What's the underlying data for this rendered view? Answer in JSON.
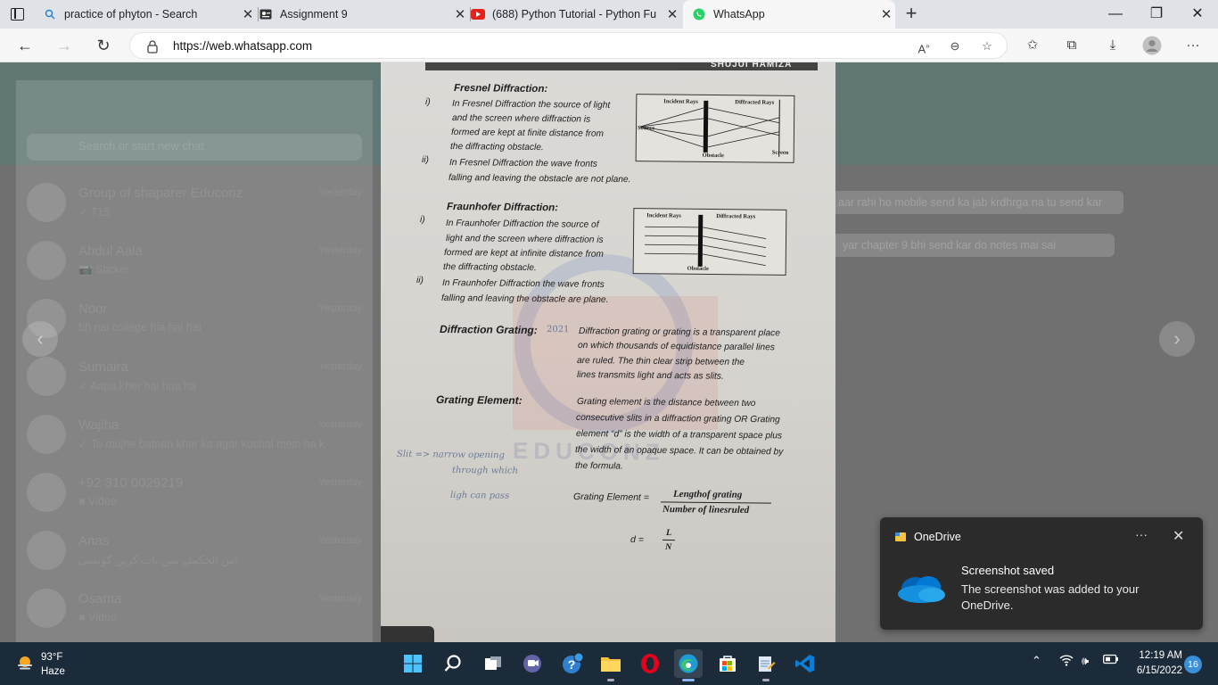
{
  "browser": {
    "tabs": [
      {
        "title": "practice of phyton - Search",
        "icon": "search-icon",
        "active": false
      },
      {
        "title": "Assignment 9",
        "icon": "assignment-icon",
        "active": false
      },
      {
        "title": "(688) Python Tutorial - Python Fu",
        "icon": "youtube-icon",
        "active": false
      },
      {
        "title": "WhatsApp",
        "icon": "whatsapp-icon",
        "active": true
      }
    ],
    "url": "https://web.whatsapp.com",
    "colors": {
      "tabstrip": "#dfe3e8",
      "toolbar": "#f7f7f7",
      "youtube": "#e62117",
      "whatsapp": "#25d366"
    }
  },
  "whatsapp": {
    "search_placeholder": "Search or start new chat",
    "chats": [
      {
        "name": "Group of shaparer Educonz",
        "msg": "✓ T15",
        "time": "Yesterday"
      },
      {
        "name": "Abdul Aala",
        "msg": "📷 Sticker",
        "time": "Yesterday"
      },
      {
        "name": "Noor",
        "msg": "bh nai college hia hai hai",
        "time": "Yesterday"
      },
      {
        "name": "Sumaira",
        "msg": "✓ Aapa kher hai hua ha",
        "time": "Yesterday"
      },
      {
        "name": "Wajiha",
        "msg": "✓ To mujhe batnah kher ka agar kuchal mein ha k",
        "time": "Yesterday"
      },
      {
        "name": "+92 310 0029219",
        "msg": "■ Video",
        "time": "Yesterday"
      },
      {
        "name": "Anas",
        "msg": "اس الحکمتے میں بات کریں کونسی",
        "time": "Yesterday"
      },
      {
        "name": "Osama",
        "msg": "■ Video",
        "time": "Yesterday"
      }
    ],
    "messages": [
      {
        "text": "aar rahi ho mobile send ka jab krdhrga na tu send kar"
      },
      {
        "text": "yar chapter 9 bhi send kar do notes mai sai"
      }
    ]
  },
  "photo_page": {
    "top_header": "SHUJUI HAMIZA",
    "fresnel": {
      "heading": "Fresnel Diffraction:",
      "i": "i)",
      "ii": "ii)",
      "lines": [
        "In Fresnel Diffraction the source of light",
        "and the screen where diffraction is",
        "formed are kept at finite distance from",
        "the diffracting obstacle.",
        "In Fresnel Diffraction the wave fronts",
        "falling and leaving the obstacle are not plane."
      ],
      "diagram": {
        "incident": "Incident Rays",
        "diffracted": "Diffracted Rays",
        "source": "Source",
        "obstacle": "Obstacle",
        "screen": "Screen"
      }
    },
    "fraunhofer": {
      "heading": "Fraunhofer Diffraction:",
      "i": "i)",
      "ii": "ii)",
      "lines": [
        "In Fraunhofer Diffraction the source of",
        "light and the screen where diffraction is",
        "formed are kept at infinite distance from",
        "the diffracting obstacle.",
        "In Fraunhofer Diffraction the wave fronts",
        "falling and leaving the obstacle are plane."
      ],
      "diagram": {
        "incident": "Incident Rays",
        "diffracted": "Diffracted Rays",
        "obstacle": "Obstacle"
      }
    },
    "grating": {
      "heading": "Diffraction Grating:",
      "year_note": "2021",
      "lines": [
        "Diffraction grating or grating is a transparent  place",
        "on which thousands of equidistance parallel lines",
        "are ruled. The thin clear strip between the",
        "lines transmits light and acts as slits."
      ]
    },
    "element": {
      "heading": "Grating Element:",
      "lines": [
        "Grating element is the distance between two",
        "consecutive slits in a diffraction grating OR Grating",
        "element “d” is the width of a transparent space plus",
        "the width of an opaque space. It can be obtained by",
        "the formula."
      ],
      "formula_label": "Grating Element =",
      "numerator": "Lengthof  grating",
      "denominator": "Number of  linesruled",
      "d_label": "d  =",
      "d_num": "L",
      "d_den": "N"
    },
    "handwriting": [
      "Slit =>  narrow  opening",
      "through  which",
      "ligh  can  pass"
    ],
    "watermark": "EDUCONZ"
  },
  "toast": {
    "app": "OneDrive",
    "title": "Screenshot saved",
    "body": "The screenshot was added to your OneDrive.",
    "more": "···",
    "close": "✕"
  },
  "taskbar": {
    "weather_temp": "93°F",
    "weather_desc": "Haze",
    "time": "12:19 AM",
    "date": "6/15/2022",
    "notifications": "16",
    "apps": [
      "windows-start",
      "search",
      "task-view",
      "teams-chat",
      "help",
      "file-explorer",
      "opera",
      "edge",
      "microsoft-store",
      "notepad",
      "vscode"
    ]
  }
}
